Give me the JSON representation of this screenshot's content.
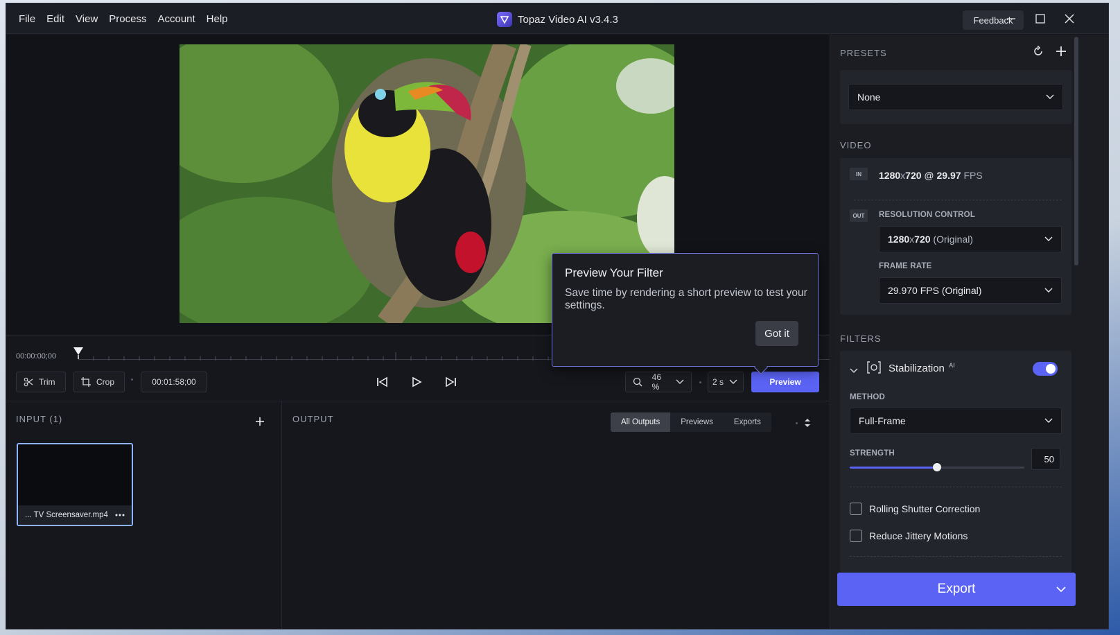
{
  "menu": [
    "File",
    "Edit",
    "View",
    "Process",
    "Account",
    "Help"
  ],
  "app_title": "Topaz Video AI  v3.4.3",
  "feedback_label": "Feedback",
  "timeline": {
    "start_time": "00:00:00;00",
    "trim_label": "Trim",
    "crop_label": "Crop",
    "duration": "00:01:58;00",
    "zoom": "46 %",
    "preview_length": "2 s",
    "preview_label": "Preview"
  },
  "tooltip": {
    "title": "Preview Your Filter",
    "body": "Save time by rendering a short preview to test your settings.",
    "button": "Got it"
  },
  "input": {
    "header": "INPUT (1)",
    "file_name": "... TV Screensaver.mp4"
  },
  "output": {
    "header": "OUTPUT",
    "tabs": [
      "All Outputs",
      "Previews",
      "Exports"
    ],
    "active_tab": "All Outputs"
  },
  "sidebar": {
    "presets_header": "PRESETS",
    "preset_value": "None",
    "video_header": "VIDEO",
    "in_tag": "IN",
    "in_res": "1280",
    "in_x": "x",
    "in_res2": "720",
    "in_at": " @ ",
    "in_fps": "29.97",
    "in_fps_unit": " FPS",
    "out_tag": "OUT",
    "resolution_control_label": "RESOLUTION CONTROL",
    "resolution_main": "1280",
    "resolution_x": "x",
    "resolution_main2": "720",
    "resolution_suffix": " (Original)",
    "frame_rate_label": "FRAME RATE",
    "frame_rate_value": "29.970 FPS (Original)",
    "filters_header": "FILTERS",
    "filter_name": "Stabilization",
    "filter_badge": "AI",
    "filter_enabled": true,
    "method_label": "METHOD",
    "method_value": "Full-Frame",
    "strength_label": "STRENGTH",
    "strength_value": "50",
    "strength_fraction": 0.5,
    "option_rolling": "Rolling Shutter Correction",
    "option_jittery": "Reduce Jittery Motions",
    "export_label": "Export"
  },
  "colors": {
    "accent": "#5b63f5",
    "panel": "#1b1d23",
    "background": "#15171d"
  }
}
